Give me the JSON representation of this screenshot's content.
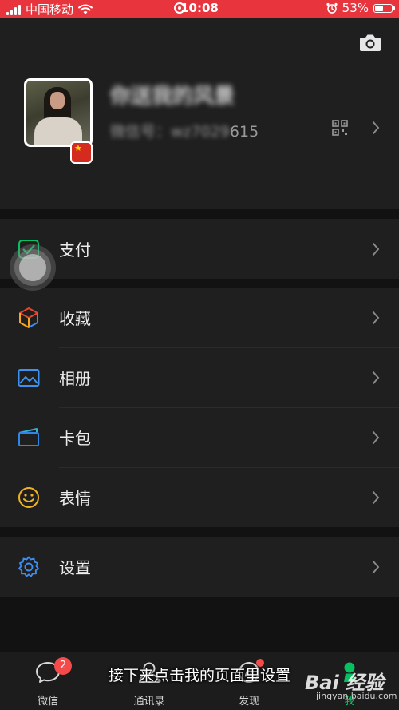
{
  "status_bar": {
    "carrier": "中国移动",
    "time": "10:08",
    "battery": "53%",
    "battery_level": 0.53
  },
  "profile": {
    "nickname": "你送我的风景",
    "wxid_label": "微信号：",
    "wxid_hidden": "wz7029",
    "wxid_visible": "615"
  },
  "menu": {
    "pay": "支付",
    "favorites": "收藏",
    "album": "相册",
    "cards": "卡包",
    "stickers": "表情",
    "settings": "设置"
  },
  "tabs": [
    {
      "label": "微信",
      "badge": "2"
    },
    {
      "label": "通讯录"
    },
    {
      "label": "发现"
    },
    {
      "label": "我"
    }
  ],
  "overlay": {
    "caption": "接下来点击我的页面里设置",
    "watermark_main": "Bai 经验",
    "watermark_sub": "jingyan.baidu.com"
  },
  "colors": {
    "status_bar": "#e8353d",
    "accent_green": "#07c160",
    "badge_red": "#f44a4a"
  }
}
